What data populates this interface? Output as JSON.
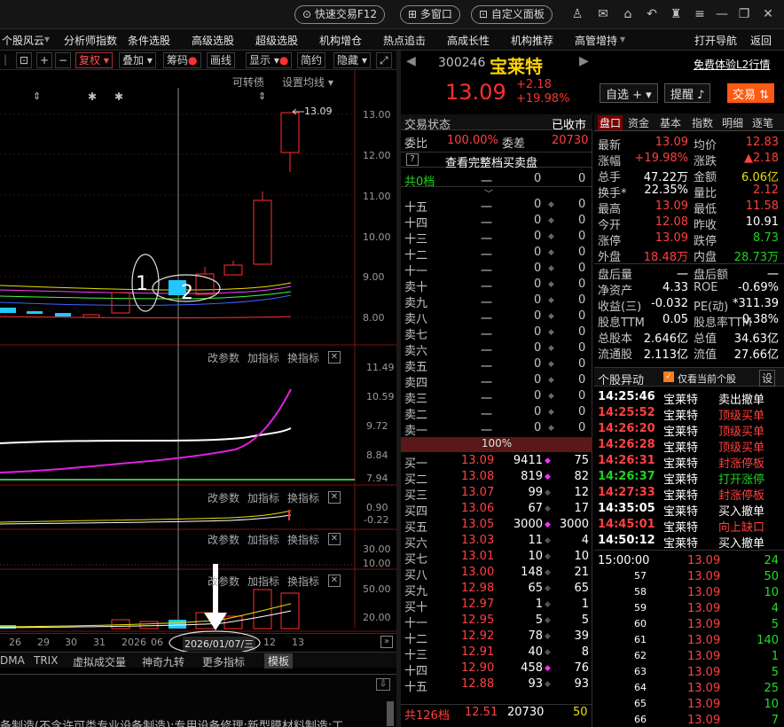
{
  "titlebar": {
    "quick_trade": "快速交易F12",
    "multi_window": "多窗口",
    "custom_panel": "自定义面板"
  },
  "menu": [
    "个股风云",
    "分析师指数",
    "条件选股",
    "高级选股",
    "超级选股",
    "机构增仓",
    "热点追击",
    "高成长性",
    "机构推荐",
    "高管增持",
    "打开导航",
    "返回"
  ],
  "chart_toolbar": {
    "fuquan": "复权",
    "overlay": "叠加",
    "chip": "筹码",
    "draw": "画线",
    "display": "显示",
    "simple": "简约",
    "hide": "隐藏"
  },
  "chart": {
    "top_labels": {
      "convertible": "可转债",
      "set_ma": "设置均线"
    },
    "price_axis": [
      "13.00",
      "12.00",
      "11.00",
      "10.00",
      "9.00",
      "8.00"
    ],
    "high_label": "13.09",
    "annotations": [
      "1",
      "2"
    ],
    "panel2": {
      "params": "改参数",
      "add": "加指标",
      "switch": "换指标",
      "axis": [
        "11.49",
        "10.59",
        "9.72",
        "8.84",
        "7.94"
      ]
    },
    "panel3": {
      "params": "改参数",
      "add": "加指标",
      "switch": "换指标",
      "axis": [
        "0.90",
        "-0.22"
      ]
    },
    "panel4": {
      "params": "改参数",
      "add": "加指标",
      "switch": "换指标",
      "axis": [
        "30.00",
        "10.00"
      ]
    },
    "panel5": {
      "params": "改参数",
      "add": "加指标",
      "switch": "换指标",
      "axis": [
        "50.00",
        "20.00"
      ]
    },
    "x_axis": [
      "26",
      "29",
      "30",
      "31",
      "2026",
      "06",
      "12",
      "13"
    ],
    "date_box": "2026/01/07/三",
    "bottom_tabs": [
      "DMA",
      "TRIX",
      "虚拟成交量",
      "神奇九转",
      "更多指标",
      "模板"
    ],
    "footer_text": "备制造(不含许可类专业设备制造);专用设备修理;新型膜材料制造;工"
  },
  "stock": {
    "code": "300246",
    "name": "宝莱特",
    "l2_link": "免费体验L2行情",
    "price": "13.09",
    "change": "+2.18",
    "pct": "+19.98%",
    "btn_watch": "自选",
    "btn_alert": "提醒",
    "btn_trade": "交易"
  },
  "orderbook": {
    "status_label": "交易状态",
    "status_value": "已收市",
    "weibi_label": "委比",
    "weibi_value": "100.00%",
    "weicha_label": "委差",
    "weicha_value": "20730",
    "full_book": "查看完整档买卖盘",
    "total_sell": {
      "label": "共0档",
      "price": "一",
      "vol": "0",
      "cnt": "0"
    },
    "sells": [
      {
        "label": "十五",
        "price": "一",
        "vol": "0",
        "cnt": "0"
      },
      {
        "label": "十四",
        "price": "一",
        "vol": "0",
        "cnt": "0"
      },
      {
        "label": "十三",
        "price": "一",
        "vol": "0",
        "cnt": "0"
      },
      {
        "label": "十二",
        "price": "一",
        "vol": "0",
        "cnt": "0"
      },
      {
        "label": "十一",
        "price": "一",
        "vol": "0",
        "cnt": "0"
      },
      {
        "label": "卖十",
        "price": "一",
        "vol": "0",
        "cnt": "0"
      },
      {
        "label": "卖九",
        "price": "一",
        "vol": "0",
        "cnt": "0"
      },
      {
        "label": "卖八",
        "price": "一",
        "vol": "0",
        "cnt": "0"
      },
      {
        "label": "卖七",
        "price": "一",
        "vol": "0",
        "cnt": "0"
      },
      {
        "label": "卖六",
        "price": "一",
        "vol": "0",
        "cnt": "0"
      },
      {
        "label": "卖五",
        "price": "一",
        "vol": "0",
        "cnt": "0"
      },
      {
        "label": "卖四",
        "price": "一",
        "vol": "0",
        "cnt": "0"
      },
      {
        "label": "卖三",
        "price": "一",
        "vol": "0",
        "cnt": "0"
      },
      {
        "label": "卖二",
        "price": "一",
        "vol": "0",
        "cnt": "0"
      },
      {
        "label": "卖一",
        "price": "一",
        "vol": "0",
        "cnt": "0"
      }
    ],
    "ratio_bar": "100%",
    "buys": [
      {
        "label": "买一",
        "price": "13.09",
        "vol": "9411",
        "cnt": "75"
      },
      {
        "label": "买二",
        "price": "13.08",
        "vol": "819",
        "cnt": "82"
      },
      {
        "label": "买三",
        "price": "13.07",
        "vol": "99",
        "cnt": "12"
      },
      {
        "label": "买四",
        "price": "13.06",
        "vol": "67",
        "cnt": "17"
      },
      {
        "label": "买五",
        "price": "13.05",
        "vol": "3000",
        "cnt": "3000"
      },
      {
        "label": "买六",
        "price": "13.03",
        "vol": "11",
        "cnt": "4"
      },
      {
        "label": "买七",
        "price": "13.01",
        "vol": "10",
        "cnt": "10"
      },
      {
        "label": "买八",
        "price": "13.00",
        "vol": "148",
        "cnt": "21"
      },
      {
        "label": "买九",
        "price": "12.98",
        "vol": "65",
        "cnt": "65"
      },
      {
        "label": "买十",
        "price": "12.97",
        "vol": "1",
        "cnt": "1"
      },
      {
        "label": "十一",
        "price": "12.95",
        "vol": "5",
        "cnt": "5"
      },
      {
        "label": "十二",
        "price": "12.92",
        "vol": "78",
        "cnt": "39"
      },
      {
        "label": "十三",
        "price": "12.91",
        "vol": "40",
        "cnt": "8"
      },
      {
        "label": "十四",
        "price": "12.90",
        "vol": "458",
        "cnt": "76"
      },
      {
        "label": "十五",
        "price": "12.88",
        "vol": "93",
        "cnt": "93"
      }
    ],
    "total_buy": {
      "label": "共126档",
      "price": "12.51",
      "vol": "20730",
      "cnt": "50"
    }
  },
  "tabs": [
    "盘口",
    "资金",
    "基本",
    "指数",
    "明细",
    "逐笔"
  ],
  "quote": [
    {
      "l": "最新",
      "v": "13.09",
      "l2": "均价",
      "v2": "12.83"
    },
    {
      "l": "涨幅",
      "v": "+19.98%",
      "l2": "涨跌",
      "v2": "▲2.18"
    },
    {
      "l": "总手",
      "v": "47.22万",
      "l2": "金额",
      "v2": "6.06亿"
    },
    {
      "l": "换手*",
      "v": "22.35%",
      "l2": "量比",
      "v2": "2.12"
    },
    {
      "l": "最高",
      "v": "13.09",
      "l2": "最低",
      "v2": "11.58"
    },
    {
      "l": "今开",
      "v": "12.08",
      "l2": "昨收",
      "v2": "10.91"
    },
    {
      "l": "涨停",
      "v": "13.09",
      "l2": "跌停",
      "v2": "8.73"
    },
    {
      "l": "外盘",
      "v": "18.48万",
      "l2": "内盘",
      "v2": "28.73万"
    },
    {
      "l": "盘后量",
      "v": "一",
      "l2": "盘后额",
      "v2": "一"
    },
    {
      "l": "净资产",
      "v": "4.33",
      "l2": "ROE",
      "v2": "-0.69%"
    },
    {
      "l": "收益(三)",
      "v": "-0.032",
      "l2": "PE(动)",
      "v2": "*311.39"
    },
    {
      "l": "股息TTM",
      "v": "0.05",
      "l2": "股息率TTM",
      "v2": "0.38%"
    },
    {
      "l": "总股本",
      "v": "2.646亿",
      "l2": "总值",
      "v2": "34.63亿"
    },
    {
      "l": "流通股",
      "v": "2.113亿",
      "l2": "流值",
      "v2": "27.66亿"
    }
  ],
  "yidong": {
    "title": "个股异动",
    "only_current": "仅看当前个股",
    "settings": "设",
    "rows": [
      {
        "t": "14:25:46",
        "n": "宝莱特",
        "e": "卖出撤单"
      },
      {
        "t": "14:25:52",
        "n": "宝莱特",
        "e": "顶级买单"
      },
      {
        "t": "14:26:20",
        "n": "宝莱特",
        "e": "顶级买单"
      },
      {
        "t": "14:26:28",
        "n": "宝莱特",
        "e": "顶级买单"
      },
      {
        "t": "14:26:31",
        "n": "宝莱特",
        "e": "封涨停板"
      },
      {
        "t": "14:26:37",
        "n": "宝莱特",
        "e": "打开涨停"
      },
      {
        "t": "14:27:33",
        "n": "宝莱特",
        "e": "封涨停板"
      },
      {
        "t": "14:35:05",
        "n": "宝莱特",
        "e": "买入撤单"
      },
      {
        "t": "14:45:01",
        "n": "宝莱特",
        "e": "向上缺口"
      },
      {
        "t": "14:50:12",
        "n": "宝莱特",
        "e": "买入撤单"
      }
    ]
  },
  "ticks": [
    {
      "t": "15:00:00",
      "p": "13.09",
      "v": "24"
    },
    {
      "t": "57",
      "p": "13.09",
      "v": "50"
    },
    {
      "t": "58",
      "p": "13.09",
      "v": "10"
    },
    {
      "t": "59",
      "p": "13.09",
      "v": "4"
    },
    {
      "t": "60",
      "p": "13.09",
      "v": "5"
    },
    {
      "t": "61",
      "p": "13.09",
      "v": "140"
    },
    {
      "t": "62",
      "p": "13.09",
      "v": "1"
    },
    {
      "t": "63",
      "p": "13.09",
      "v": "5"
    },
    {
      "t": "64",
      "p": "13.09",
      "v": "25"
    },
    {
      "t": "65",
      "p": "13.09",
      "v": "10"
    },
    {
      "t": "66",
      "p": "13.09",
      "v": "7"
    }
  ]
}
